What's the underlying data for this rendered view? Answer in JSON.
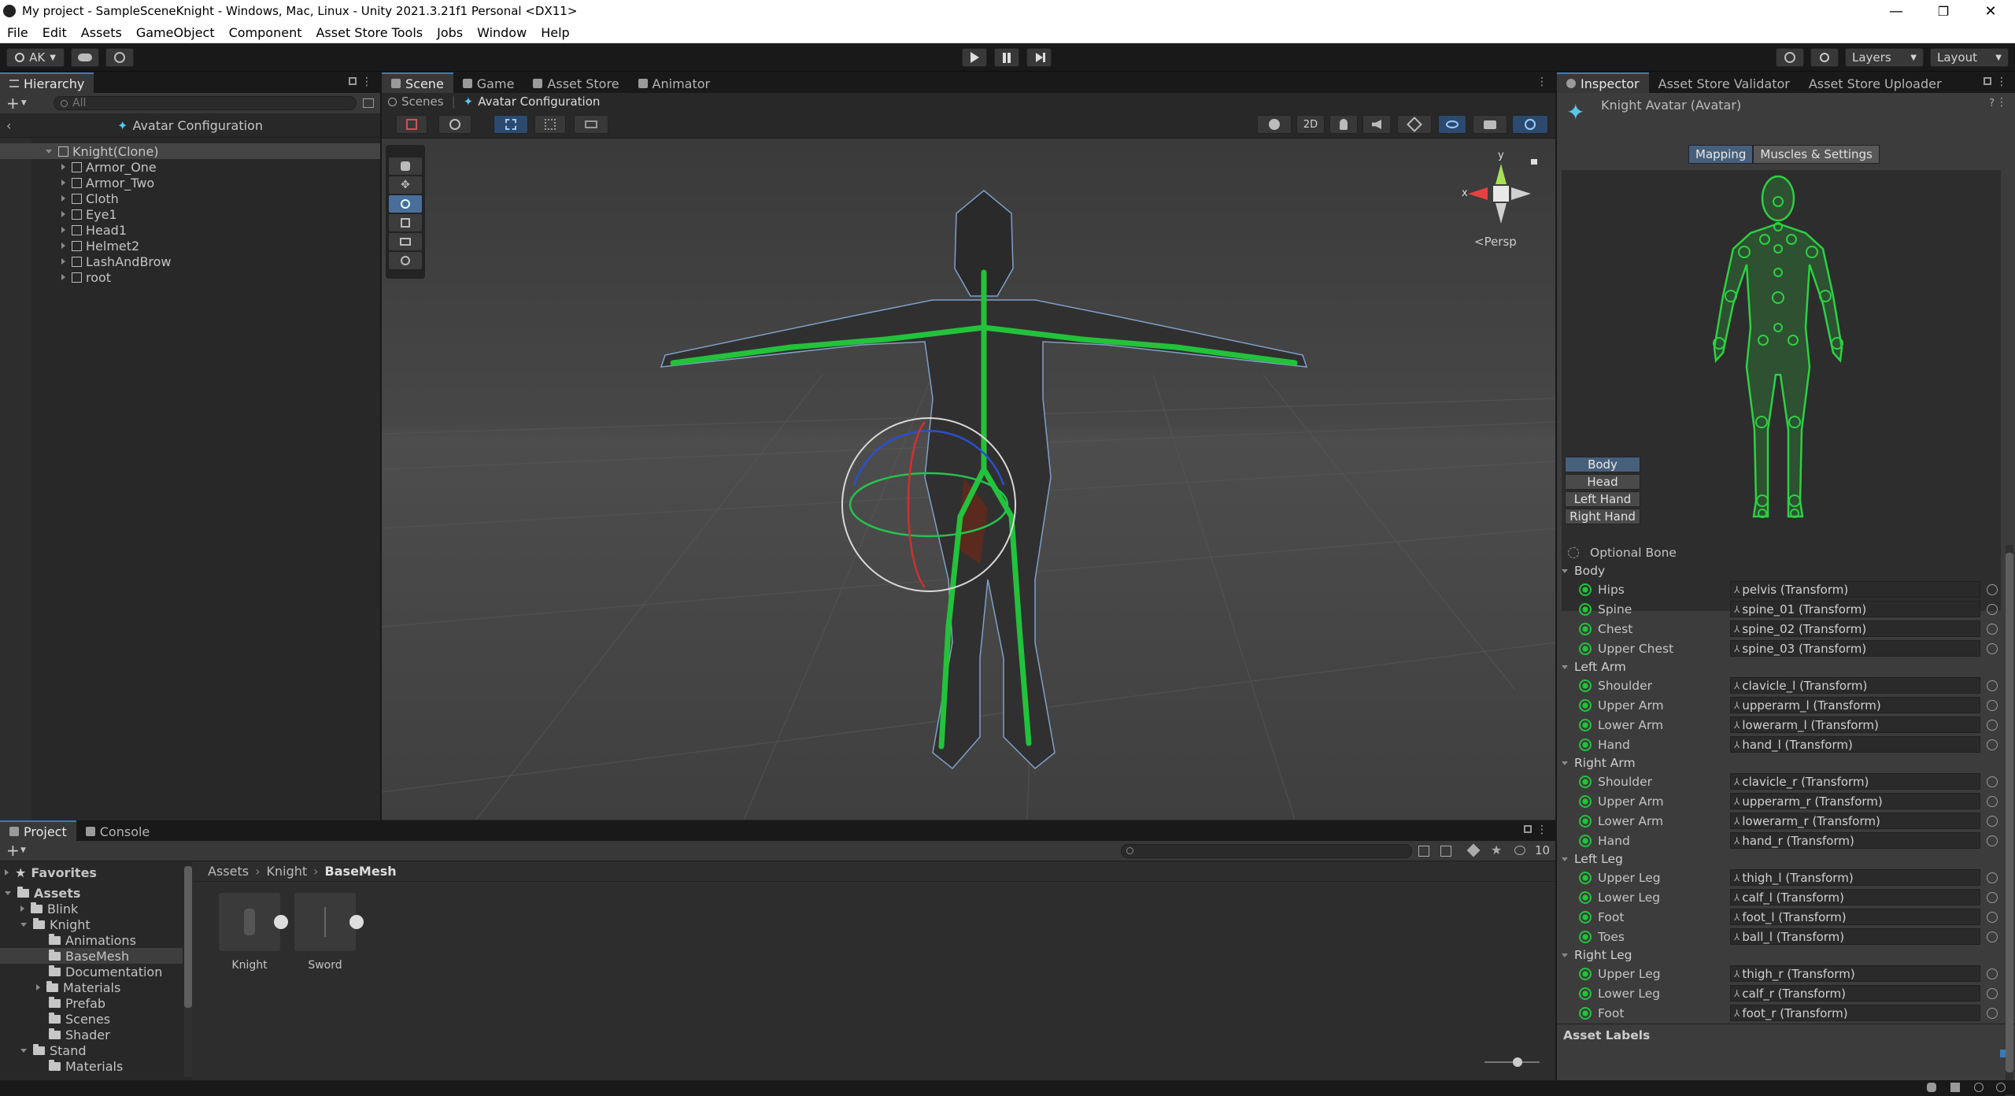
{
  "window": {
    "title": "My project - SampleSceneKnight - Windows, Mac, Linux - Unity 2021.3.21f1 Personal <DX11>",
    "minimize": "—",
    "maximize": "❐",
    "close": "✕"
  },
  "menu": [
    "File",
    "Edit",
    "Assets",
    "GameObject",
    "Component",
    "Asset Store Tools",
    "Jobs",
    "Window",
    "Help"
  ],
  "toolbar": {
    "account": "AK",
    "layers": "Layers",
    "layout": "Layout"
  },
  "hierarchy": {
    "tab": "Hierarchy",
    "search_placeholder": "All",
    "header": "Avatar Configuration",
    "root": "Knight(Clone)",
    "children": [
      "Armor_One",
      "Armor_Two",
      "Cloth",
      "Eye1",
      "Head1",
      "Helmet2",
      "LashAndBrow",
      "root"
    ]
  },
  "scene_tabs": [
    "Scene",
    "Game",
    "Asset Store",
    "Animator"
  ],
  "scene": {
    "breadcrumb_root": "Scenes",
    "breadcrumb_current": "Avatar Configuration",
    "btn_2d": "2D",
    "persp": "<Persp",
    "gizmo_y": "y",
    "gizmo_x": "x"
  },
  "inspector": {
    "tabs": [
      "Inspector",
      "Asset Store Validator",
      "Asset Store Uploader"
    ],
    "title": "Knight Avatar (Avatar)",
    "subtabs": [
      "Mapping",
      "Muscles & Settings"
    ],
    "view_buttons": [
      "Body",
      "Head",
      "Left Hand",
      "Right Hand"
    ],
    "optional_bone": "Optional Bone",
    "groups": [
      {
        "name": "Body",
        "bones": [
          [
            "Hips",
            "pelvis (Transform)"
          ],
          [
            "Spine",
            "spine_01 (Transform)"
          ],
          [
            "Chest",
            "spine_02 (Transform)"
          ],
          [
            "Upper Chest",
            "spine_03 (Transform)"
          ]
        ]
      },
      {
        "name": "Left Arm",
        "bones": [
          [
            "Shoulder",
            "clavicle_l (Transform)"
          ],
          [
            "Upper Arm",
            "upperarm_l (Transform)"
          ],
          [
            "Lower Arm",
            "lowerarm_l (Transform)"
          ],
          [
            "Hand",
            "hand_l (Transform)"
          ]
        ]
      },
      {
        "name": "Right Arm",
        "bones": [
          [
            "Shoulder",
            "clavicle_r (Transform)"
          ],
          [
            "Upper Arm",
            "upperarm_r (Transform)"
          ],
          [
            "Lower Arm",
            "lowerarm_r (Transform)"
          ],
          [
            "Hand",
            "hand_r (Transform)"
          ]
        ]
      },
      {
        "name": "Left Leg",
        "bones": [
          [
            "Upper Leg",
            "thigh_l (Transform)"
          ],
          [
            "Lower Leg",
            "calf_l (Transform)"
          ],
          [
            "Foot",
            "foot_l (Transform)"
          ],
          [
            "Toes",
            "ball_l (Transform)"
          ]
        ]
      },
      {
        "name": "Right Leg",
        "bones": [
          [
            "Upper Leg",
            "thigh_r (Transform)"
          ],
          [
            "Lower Leg",
            "calf_r (Transform)"
          ],
          [
            "Foot",
            "foot_r (Transform)"
          ]
        ]
      }
    ],
    "asset_labels": "Asset Labels"
  },
  "project": {
    "tabs": [
      "Project",
      "Console"
    ],
    "hidden_count": "10",
    "favorites": "Favorites",
    "tree": [
      {
        "label": "Assets",
        "depth": 0,
        "open": true
      },
      {
        "label": "Blink",
        "depth": 1,
        "open": false
      },
      {
        "label": "Knight",
        "depth": 1,
        "open": true
      },
      {
        "label": "Animations",
        "depth": 2,
        "open": null
      },
      {
        "label": "BaseMesh",
        "depth": 2,
        "open": null,
        "selected": true
      },
      {
        "label": "Documentation",
        "depth": 2,
        "open": null
      },
      {
        "label": "Materials",
        "depth": 2,
        "open": false
      },
      {
        "label": "Prefab",
        "depth": 2,
        "open": null
      },
      {
        "label": "Scenes",
        "depth": 2,
        "open": null
      },
      {
        "label": "Shader",
        "depth": 2,
        "open": null
      },
      {
        "label": "Stand",
        "depth": 1,
        "open": true
      },
      {
        "label": "Materials",
        "depth": 2,
        "open": null
      }
    ],
    "breadcrumb": [
      "Assets",
      "Knight",
      "BaseMesh"
    ],
    "assets": [
      "Knight",
      "Sword"
    ]
  },
  "colors": {
    "accent": "#3a79bb",
    "bone": "#23c23b"
  }
}
